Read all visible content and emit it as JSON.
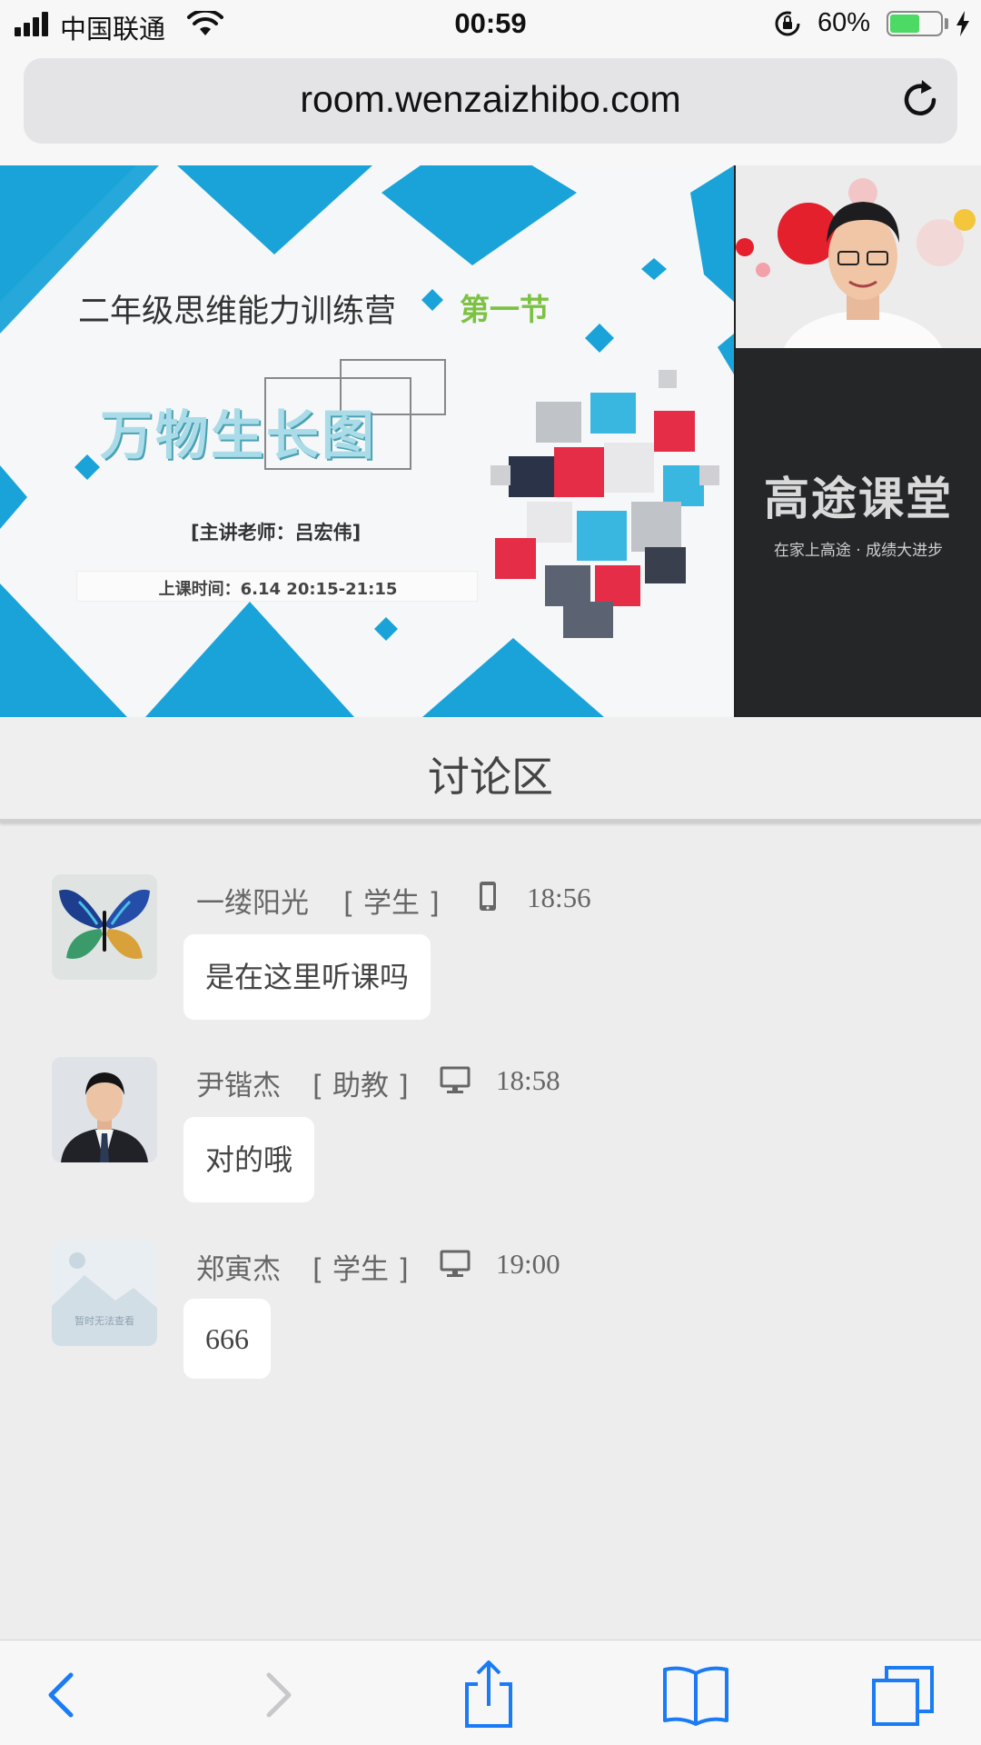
{
  "status_bar": {
    "carrier": "中国联通",
    "time": "00:59",
    "battery_percent": "60%",
    "battery_level": 0.6,
    "battery_color": "#4cd964"
  },
  "browser": {
    "url": "room.wenzaizhibo.com",
    "reload_icon": "reload-icon"
  },
  "slide": {
    "title": "二年级思维能力训练营",
    "badge": "第一节",
    "topic": "万物生长图",
    "teacher": "[主讲老师：吕宏伟]",
    "time": "上课时间：6.14   20:15-21:15"
  },
  "brand": {
    "name": "高途课堂",
    "slogan": "在家上高途 · 成绩大进步"
  },
  "discussion": {
    "title": "讨论区",
    "messages": [
      {
        "name": "一缕阳光",
        "role": "[ 学生 ]",
        "device": "phone-icon",
        "time": "18:56",
        "text": "是在这里听课吗",
        "avatar": "butterfly-avatar"
      },
      {
        "name": "尹锴杰",
        "role": "[ 助教 ]",
        "device": "desktop-icon",
        "time": "18:58",
        "text": "对的哦",
        "avatar": "portrait-avatar"
      },
      {
        "name": "郑寅杰",
        "role": "[ 学生 ]",
        "device": "desktop-icon",
        "time": "19:00",
        "text": "666",
        "avatar": "placeholder-avatar",
        "avatar_caption": "暂时无法查看"
      }
    ]
  },
  "toolbar": {
    "items": [
      "back-icon",
      "forward-icon",
      "share-icon",
      "bookmarks-icon",
      "tabs-icon"
    ],
    "accent_color": "#1a7bf5",
    "disabled_color": "#c7c7cc"
  }
}
